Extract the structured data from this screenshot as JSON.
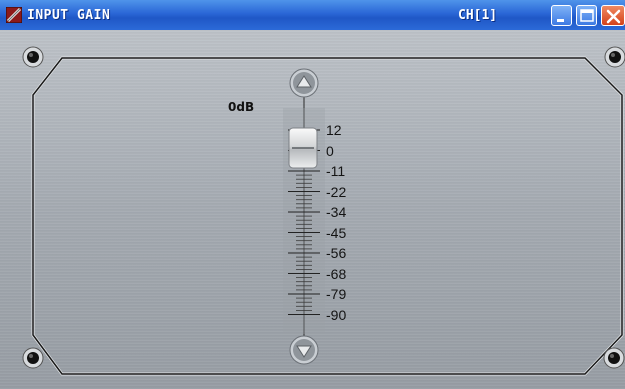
{
  "window": {
    "title": "INPUT GAIN",
    "channel": "CH[1]",
    "controls": {
      "minimize": "minimize-icon",
      "maximize": "maximize-icon",
      "close": "close-icon"
    }
  },
  "gain": {
    "readout": "0dB",
    "level_db": 0,
    "scale": [
      "12",
      "0",
      "-11",
      "-22",
      "-34",
      "-45",
      "-56",
      "-68",
      "-79",
      "-90"
    ]
  },
  "colors": {
    "titlebar": "#2a66d6",
    "panel": "#a4aab1",
    "close": "#d4421a"
  }
}
